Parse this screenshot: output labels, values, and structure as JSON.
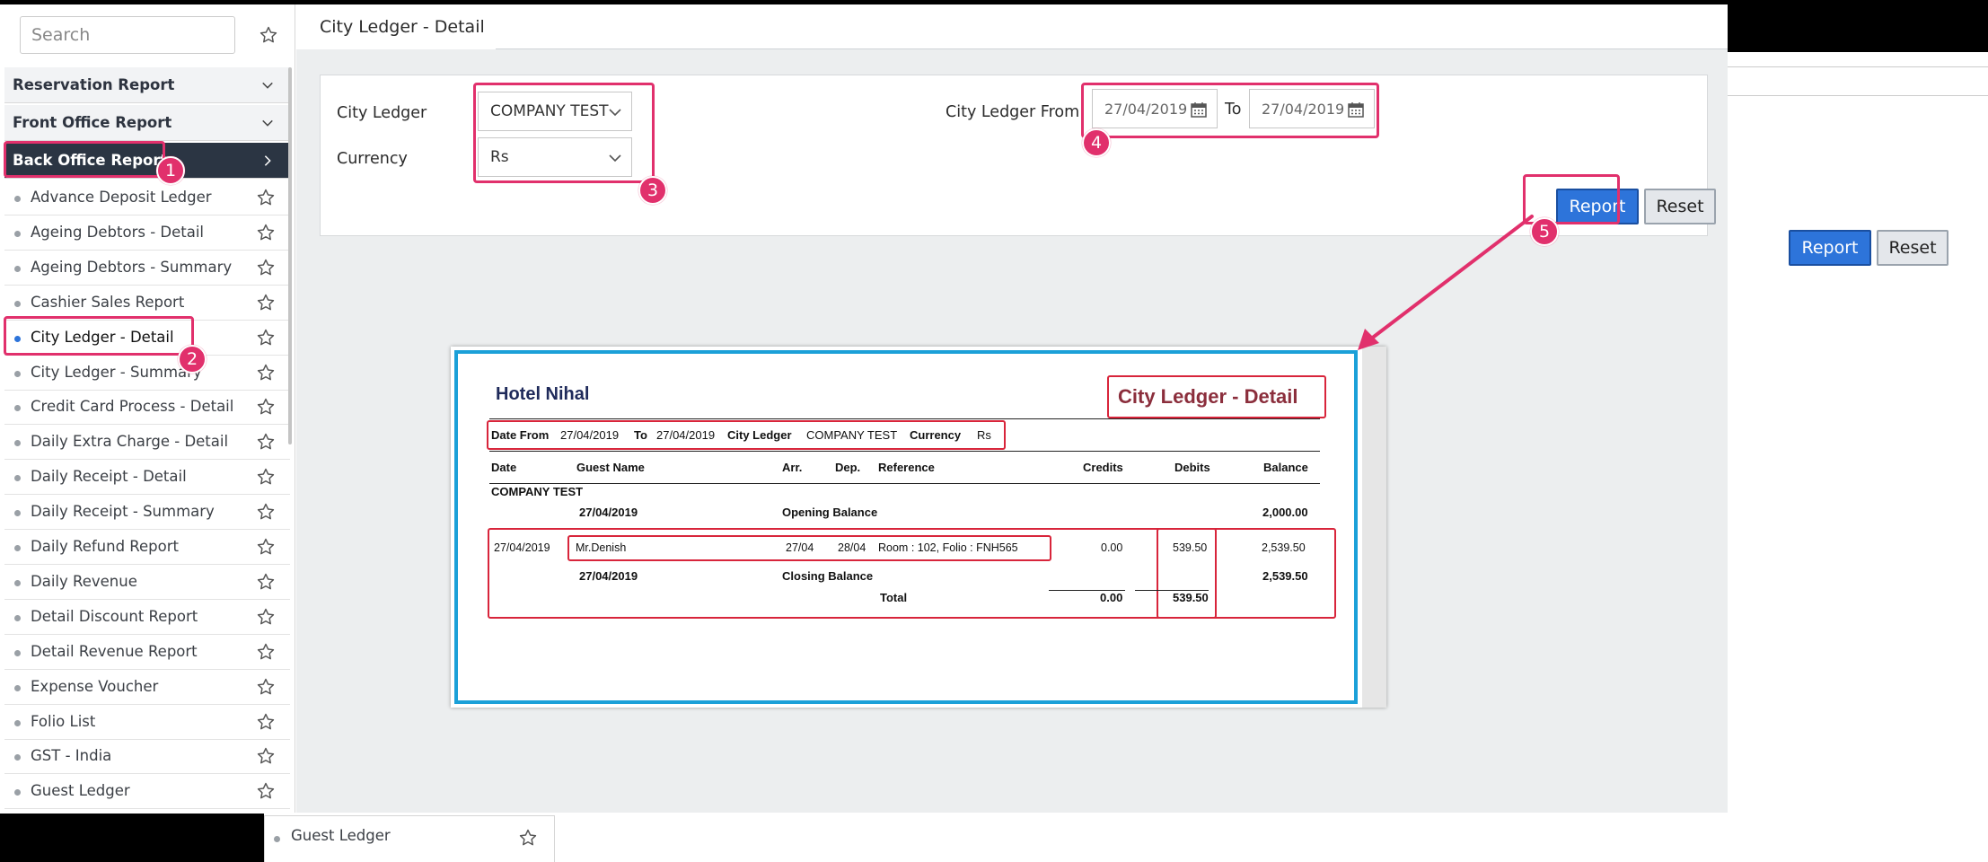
{
  "sidebar": {
    "search_placeholder": "Search",
    "categories": [
      {
        "label": "Reservation Report"
      },
      {
        "label": "Front Office Report"
      },
      {
        "label": "Back Office Report"
      }
    ],
    "items": [
      {
        "label": "Advance Deposit Ledger"
      },
      {
        "label": "Ageing Debtors - Detail"
      },
      {
        "label": "Ageing Debtors - Summary"
      },
      {
        "label": "Cashier Sales Report"
      },
      {
        "label": "City Ledger - Detail"
      },
      {
        "label": "City Ledger - Summary"
      },
      {
        "label": "Credit Card Process - Detail"
      },
      {
        "label": "Daily Extra Charge - Detail"
      },
      {
        "label": "Daily Receipt - Detail"
      },
      {
        "label": "Daily Receipt - Summary"
      },
      {
        "label": "Daily Refund Report"
      },
      {
        "label": "Daily Revenue"
      },
      {
        "label": "Detail Discount Report"
      },
      {
        "label": "Detail Revenue Report"
      },
      {
        "label": "Expense Voucher"
      },
      {
        "label": "Folio List"
      },
      {
        "label": "GST - India"
      },
      {
        "label": "Guest Ledger"
      }
    ],
    "fragment_item": "Guest Ledger"
  },
  "main": {
    "tab_title": "City Ledger - Detail",
    "form": {
      "city_ledger_label": "City Ledger",
      "city_ledger_value": "COMPANY TEST",
      "currency_label": "Currency",
      "currency_value": "Rs",
      "from_label": "City Ledger From",
      "from_date": "27/04/2019",
      "to_label": "To",
      "to_date": "27/04/2019",
      "report_button": "Report",
      "reset_button": "Reset"
    }
  },
  "badges": [
    "1",
    "2",
    "3",
    "4",
    "5"
  ],
  "report": {
    "hotel": "Hotel Nihal",
    "title": "City Ledger - Detail",
    "filter": {
      "date_from_label": "Date From",
      "date_from": "27/04/2019",
      "to_label": "To",
      "to": "27/04/2019",
      "ledger_label": "City Ledger",
      "ledger": "COMPANY TEST",
      "currency_label": "Currency",
      "currency": "Rs"
    },
    "headers": {
      "date": "Date",
      "guest": "Guest Name",
      "arr": "Arr.",
      "dep": "Dep.",
      "reference": "Reference",
      "credits": "Credits",
      "debits": "Debits",
      "balance": "Balance"
    },
    "group": "COMPANY TEST",
    "opening": {
      "date": "27/04/2019",
      "label": "Opening Balance",
      "balance": "2,000.00"
    },
    "row": {
      "date": "27/04/2019",
      "guest": "Mr.Denish",
      "arr": "27/04",
      "dep": "28/04",
      "reference": "Room : 102, Folio : FNH565",
      "credits": "0.00",
      "debits": "539.50",
      "balance": "2,539.50"
    },
    "closing": {
      "date": "27/04/2019",
      "label": "Closing Balance",
      "balance": "2,539.50"
    },
    "total": {
      "label": "Total",
      "credits": "0.00",
      "debits": "539.50"
    }
  },
  "colors": {
    "accent": "#e1306c",
    "primary_button": "#2d74da",
    "preview_border": "#1ba0d8",
    "report_highlight": "#d8253b",
    "active_category": "#2b3543"
  }
}
